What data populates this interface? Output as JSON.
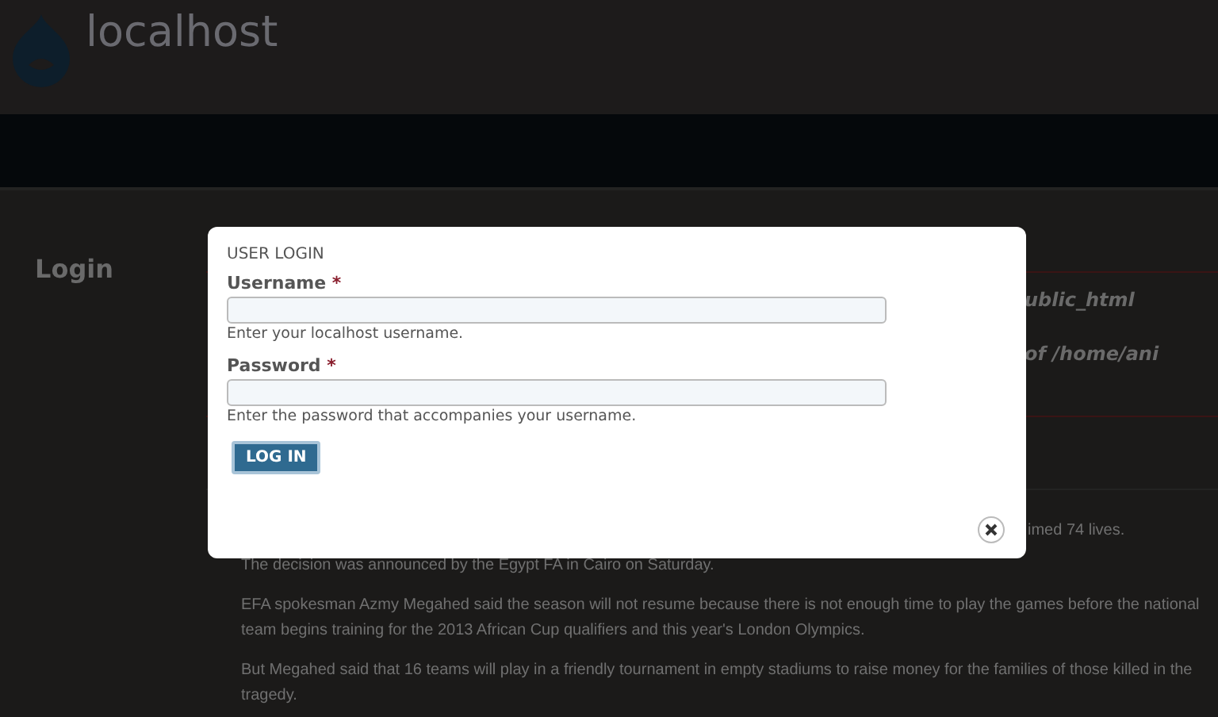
{
  "site": {
    "name": "localhost"
  },
  "sidebar": {
    "title": "Login"
  },
  "message": {
    "lines": [
      "ublic_html",
      "of /home/ani"
    ]
  },
  "article": {
    "lead_end": "imed 74 lives.",
    "paragraphs": [
      "The decision was announced by the Egypt FA in Cairo on Saturday.",
      "EFA spokesman Azmy Megahed said the season will not resume because there is not enough time to play the games before the national team begins training for the 2013 African Cup qualifiers and this year's London Olympics.",
      "But Megahed said that 16 teams will play in a friendly tournament in empty stadiums to raise money for the families of those killed in the tragedy."
    ]
  },
  "dialog": {
    "title": "USER LOGIN",
    "fields": [
      {
        "label": "Username",
        "required_mark": "*",
        "description": "Enter your localhost username."
      },
      {
        "label": "Password",
        "required_mark": "*",
        "description": "Enter the password that accompanies your username."
      }
    ],
    "submit": "LOG IN"
  }
}
